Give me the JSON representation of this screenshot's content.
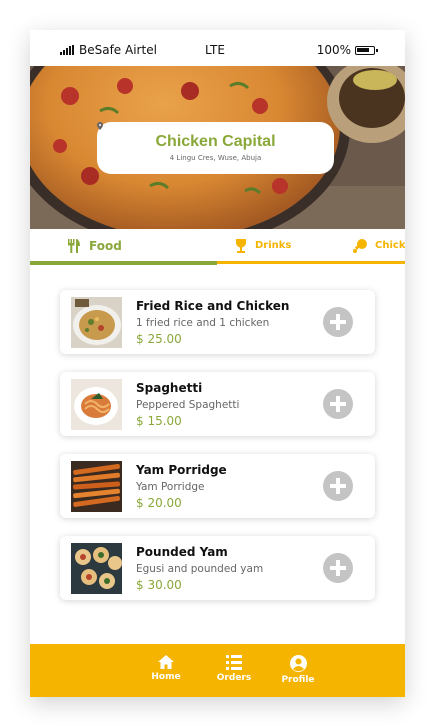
{
  "status_bar": {
    "carrier": "BeSafe Airtel",
    "network": "LTE",
    "battery": "100%"
  },
  "restaurant": {
    "name": "Chicken Capital",
    "address": "4 Lingu Cres, Wuse, Abuja"
  },
  "tabs": [
    {
      "label": "Food",
      "icon": "utensils-icon"
    },
    {
      "label": "Drinks",
      "icon": "wine-glass-icon"
    },
    {
      "label": "Chicke",
      "icon": "drumstick-icon"
    }
  ],
  "menu_items": [
    {
      "name": "Fried Rice and Chicken",
      "description": "1 fried rice and 1 chicken",
      "price": "$ 25.00"
    },
    {
      "name": "Spaghetti",
      "description": "Peppered Spaghetti",
      "price": "$ 15.00"
    },
    {
      "name": "Yam Porridge",
      "description": "Yam Porridge",
      "price": "$ 20.00"
    },
    {
      "name": "Pounded Yam",
      "description": "Egusi and pounded yam",
      "price": "$ 30.00"
    }
  ],
  "bottom_nav": [
    {
      "label": "Home",
      "icon": "home-icon"
    },
    {
      "label": "Orders",
      "icon": "list-icon"
    },
    {
      "label": "Profile",
      "icon": "user-icon"
    }
  ],
  "colors": {
    "accent_green": "#8aa83a",
    "accent_yellow": "#f5b400",
    "add_button_gray": "#c4c4c4"
  }
}
